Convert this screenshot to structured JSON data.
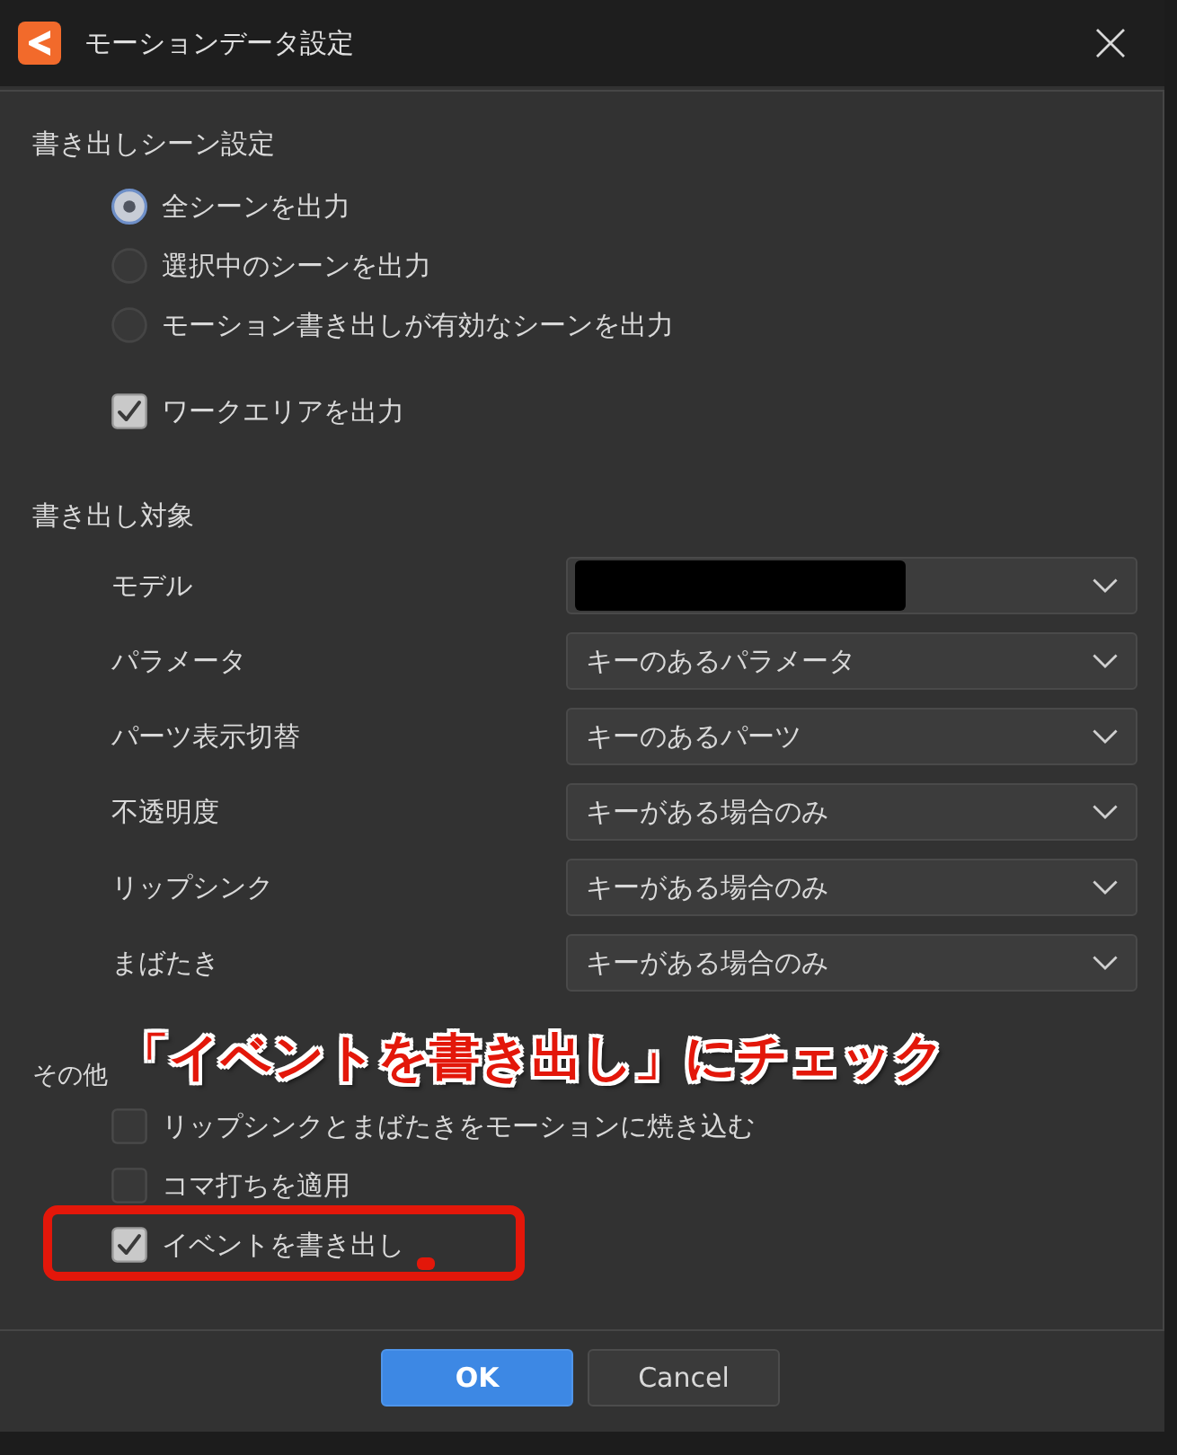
{
  "window": {
    "title": "モーションデータ設定"
  },
  "scene_section": {
    "title": "書き出しシーン設定",
    "radios": [
      {
        "label": "全シーンを出力",
        "selected": true
      },
      {
        "label": "選択中のシーンを出力",
        "selected": false
      },
      {
        "label": "モーション書き出しが有効なシーンを出力",
        "selected": false
      }
    ],
    "checkbox": {
      "label": "ワークエリアを出力",
      "checked": true
    }
  },
  "target_section": {
    "title": "書き出し対象",
    "rows": [
      {
        "label": "モデル",
        "redacted": true
      },
      {
        "label": "パラメータ",
        "redacted": false,
        "value": "キーのあるパラメータ"
      },
      {
        "label": "パーツ表示切替",
        "redacted": false,
        "value": "キーのあるパーツ"
      },
      {
        "label": "不透明度",
        "redacted": false,
        "value": "キーがある場合のみ"
      },
      {
        "label": "リップシンク",
        "redacted": false,
        "value": "キーがある場合のみ"
      },
      {
        "label": "まばたき",
        "redacted": false,
        "value": "キーがある場合のみ"
      }
    ]
  },
  "other_section": {
    "title": "その他",
    "options": [
      {
        "label": "リップシンクとまばたきをモーションに焼き込む",
        "checked": false,
        "highlighted": false
      },
      {
        "label": "コマ打ちを適用",
        "checked": false,
        "highlighted": false
      },
      {
        "label": "イベントを書き出し",
        "checked": true,
        "highlighted": true
      }
    ]
  },
  "annotation": {
    "text": "「イベントを書き出し」にチェック"
  },
  "buttons": [
    {
      "label": "OK",
      "kind": "primary"
    },
    {
      "label": "Cancel",
      "kind": "secondary"
    }
  ]
}
